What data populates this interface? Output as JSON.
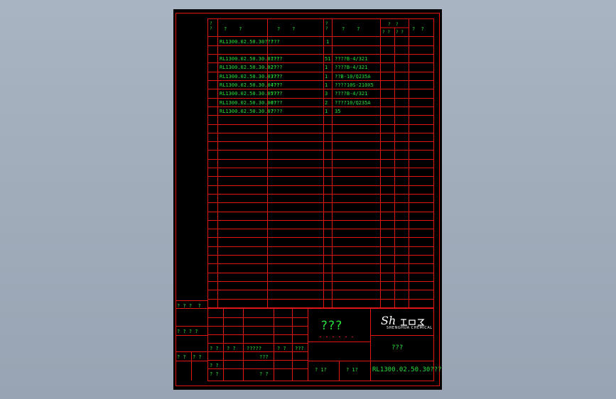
{
  "colors": {
    "background": "#a2adbb",
    "sheet": "#000000",
    "line": "#e01515",
    "text": "#27e13a"
  },
  "header": {
    "seq": "?\n?",
    "code": "?    ?",
    "name": "?    ?",
    "qty": "?\n?",
    "material": "?    ?",
    "weight_title": "?  ?",
    "weight_unit": "? ?",
    "weight_total": "? ?",
    "remark": "?  ?"
  },
  "assembly_row": {
    "code": "RL1300.02.50.30???",
    "name": "???",
    "qty": "1"
  },
  "rows": [
    {
      "code": "RL1300.02.50.30.01???",
      "name": "???",
      "qty": "51",
      "material": "????B-4/321"
    },
    {
      "code": "RL1300.02.50.30.02???",
      "name": "??",
      "qty": "1",
      "material": "????B-4/321"
    },
    {
      "code": "RL1300.02.50.30.03???",
      "name": "???",
      "qty": "1",
      "material": "??B-10/Q235A"
    },
    {
      "code": "RL1300.02.50.30.04???",
      "name": "???",
      "qty": "1",
      "material": "????10S-210X5"
    },
    {
      "code": "RL1300.02.50.30.05???",
      "name": "???",
      "qty": "3",
      "material": "????B-4/321"
    },
    {
      "code": "RL1300.02.50.30.06???",
      "name": "??",
      "qty": "2",
      "material": "????10/Q235A"
    },
    {
      "code": "RL1300.02.50.30.07???",
      "name": "?",
      "qty": "1",
      "material": "35"
    }
  ],
  "left_strip": {
    "label1": "? ? ?  ?",
    "label2": "? ? ? ?",
    "label3a": "? ?",
    "label3b": "? ?"
  },
  "title_block": {
    "r1c1": "? ?",
    "r1c2": "? ?",
    "r1c3": "?????",
    "r1c4": "? ?",
    "r1c5": "???",
    "r2c4": "???",
    "r3c1": "? ?",
    "r4c1": "? ?",
    "r4c4": "? ?",
    "drawing_name": "???",
    "company_name": "???",
    "scale_label": "? 1?",
    "sheet_label": "? 1?",
    "drawing_number": "RL1300.02.50.30???"
  },
  "logo": {
    "main": "Sh",
    "sub": "SHENGHUA CHEMICAL"
  }
}
